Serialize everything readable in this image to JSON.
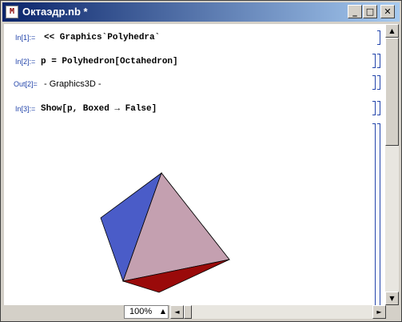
{
  "window": {
    "title": "Октаэдр.nb *",
    "app_icon": "mathematica-notebook-icon",
    "buttons": {
      "minimize": "_",
      "maximize": "□",
      "close": "✕"
    }
  },
  "cells": [
    {
      "label": "In[1]:=",
      "content": "<< Graphics`Polyhedra`"
    },
    {
      "label": "In[2]:=",
      "content": "p = Polyhedron[Octahedron]"
    },
    {
      "label": "Out[2]=",
      "content": "- Graphics3D -"
    },
    {
      "label": "In[3]:=",
      "content": "Show[p, Boxed → False]"
    }
  ],
  "graphic": {
    "description": "octahedron",
    "colors": {
      "left_face": "#4a5cc8",
      "front_face": "#c4a0b0",
      "right_face": "#b8e0a0",
      "bottom_face": "#9a0a0a"
    }
  },
  "statusbar": {
    "zoom": "100%",
    "zoom_arrow": "▲"
  },
  "scroll": {
    "up": "▲",
    "down": "▼",
    "left": "◄",
    "right": "►"
  }
}
